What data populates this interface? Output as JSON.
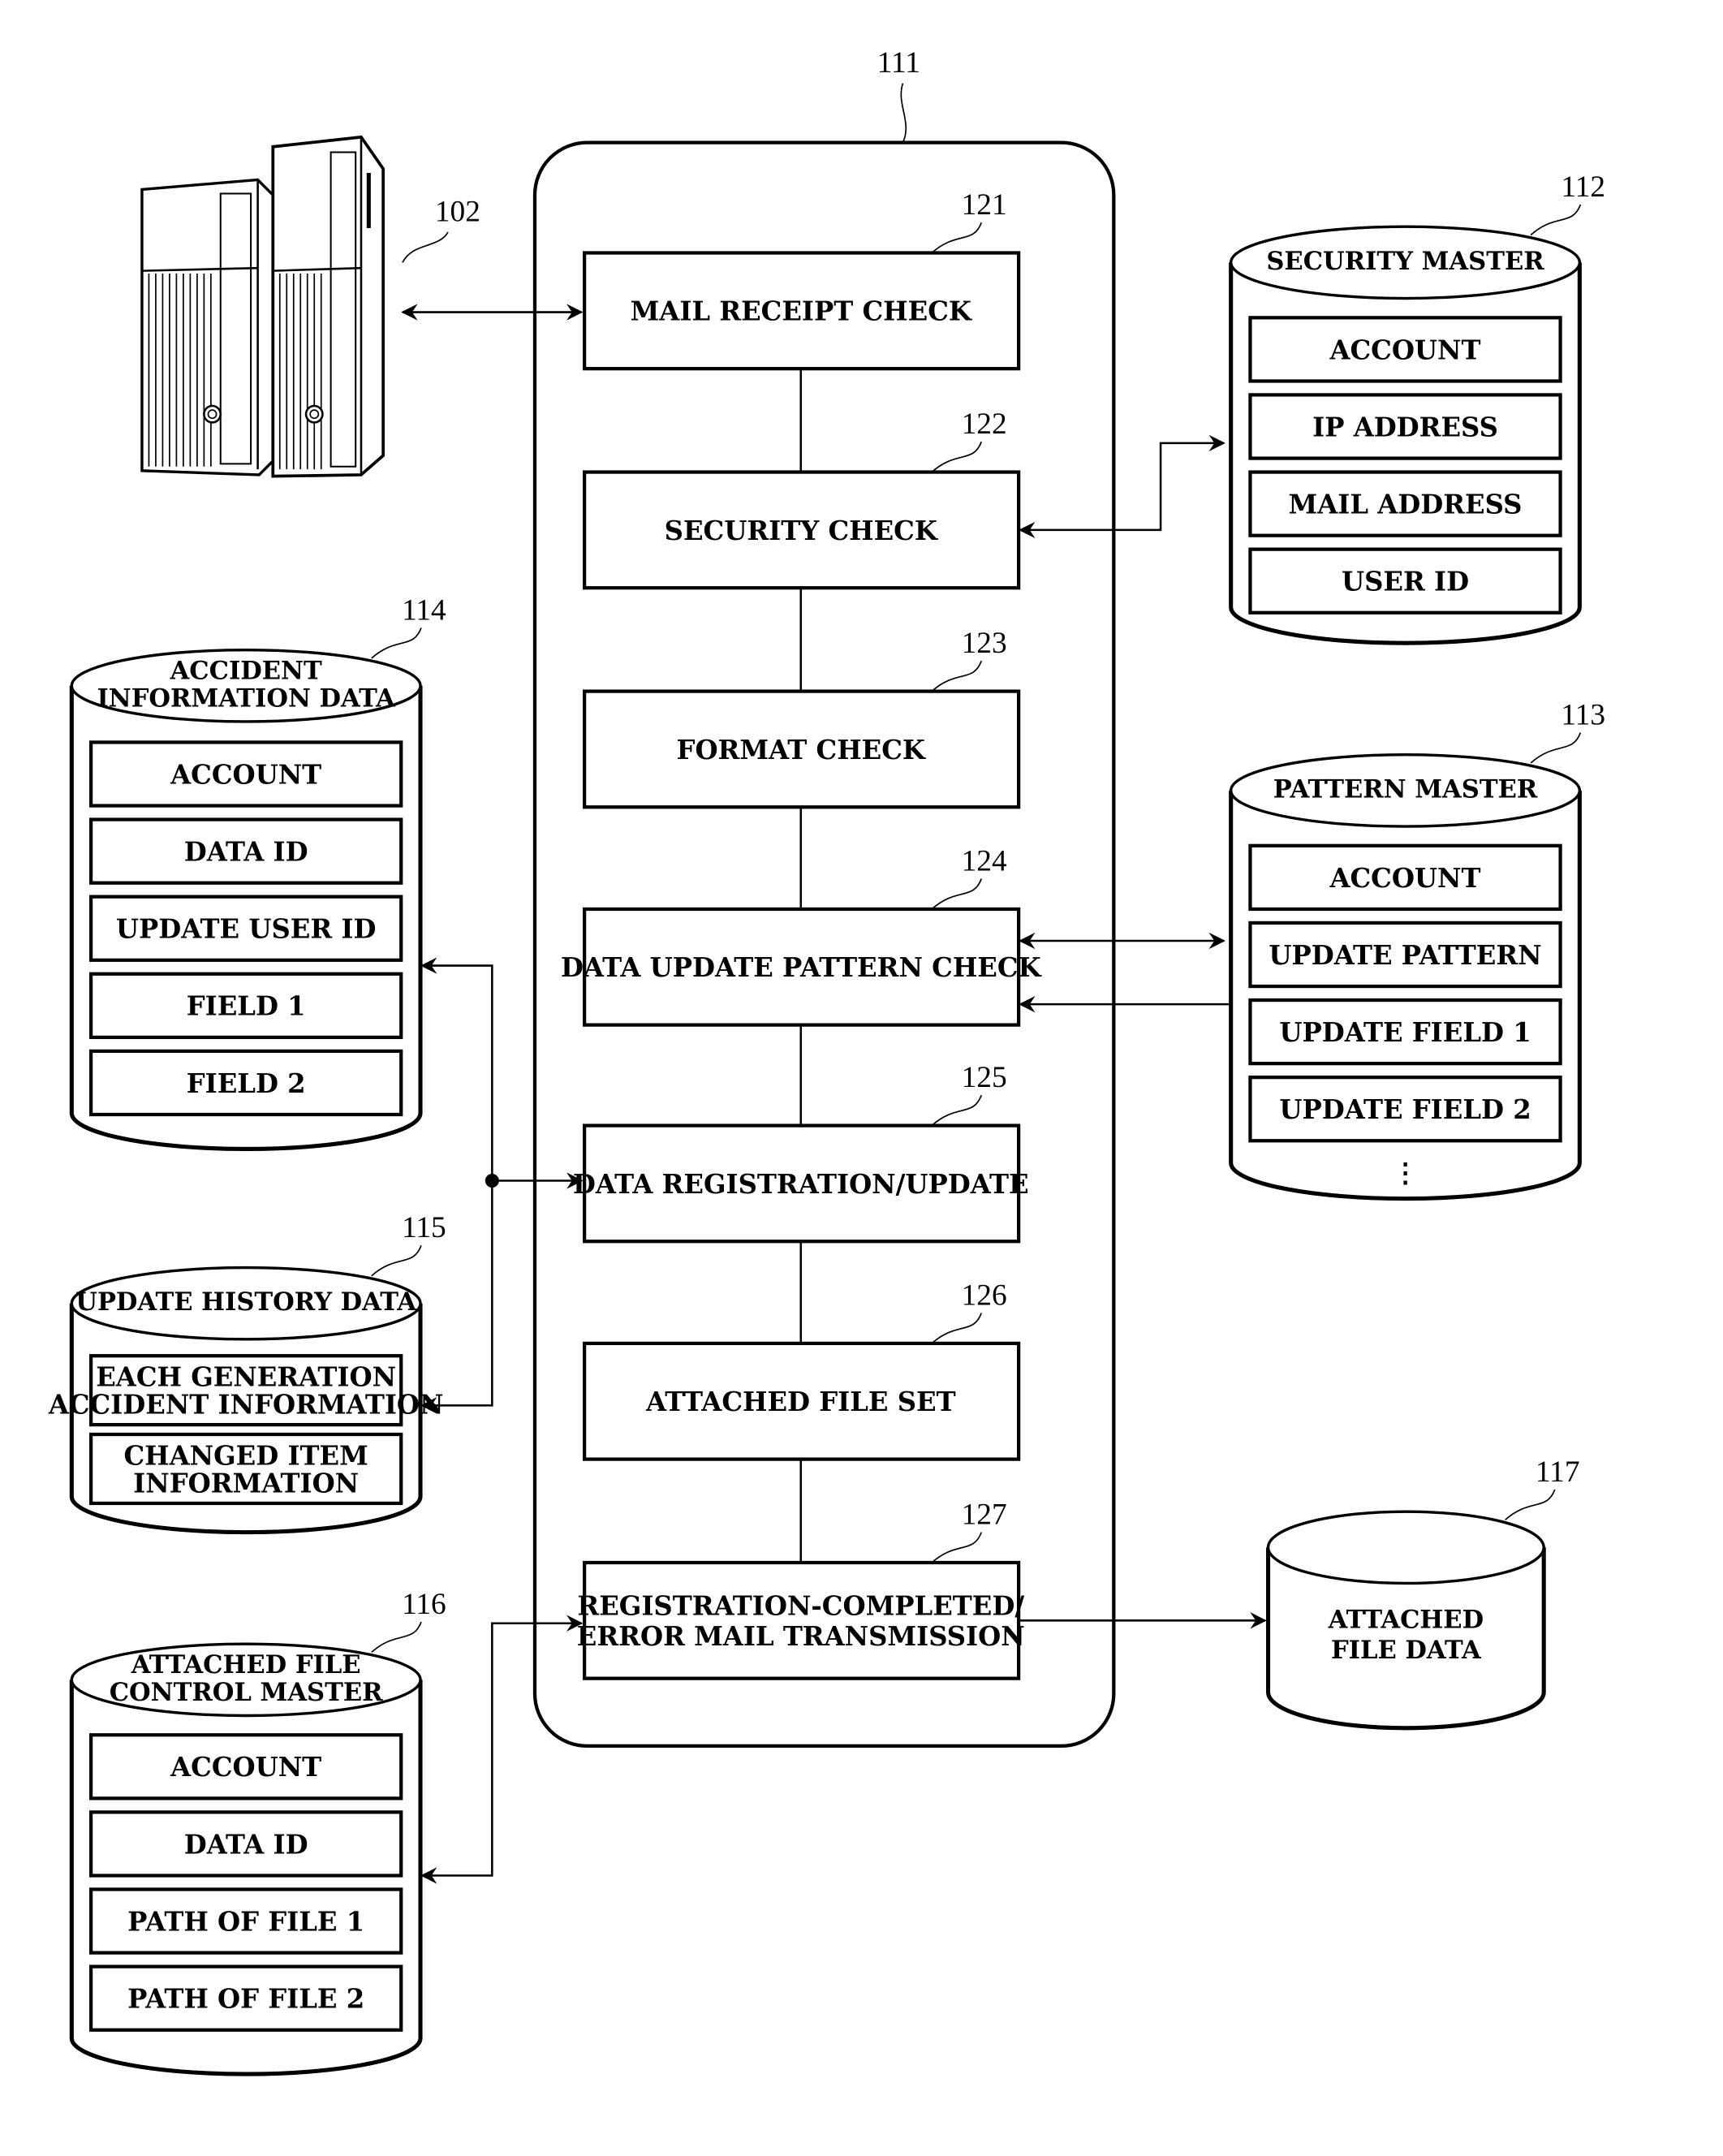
{
  "figure": {
    "colors": {
      "line": "#000000",
      "background": "#ffffff"
    },
    "server": {
      "ref": "102",
      "icon": "server-towers-icon"
    },
    "controller": {
      "ref": "111",
      "steps": [
        {
          "ref": "121",
          "label_lines": [
            "MAIL RECEIPT CHECK"
          ]
        },
        {
          "ref": "122",
          "label_lines": [
            "SECURITY CHECK"
          ]
        },
        {
          "ref": "123",
          "label_lines": [
            "FORMAT CHECK"
          ]
        },
        {
          "ref": "124",
          "label_lines": [
            "DATA UPDATE PATTERN CHECK"
          ]
        },
        {
          "ref": "125",
          "label_lines": [
            "DATA REGISTRATION/UPDATE"
          ]
        },
        {
          "ref": "126",
          "label_lines": [
            "ATTACHED FILE SET"
          ]
        },
        {
          "ref": "127",
          "label_lines": [
            "REGISTRATION-COMPLETED/",
            "ERROR MAIL TRANSMISSION"
          ]
        }
      ]
    },
    "databases": {
      "security_master": {
        "ref": "112",
        "title_lines": [
          "SECURITY MASTER"
        ],
        "fields": [
          [
            "ACCOUNT"
          ],
          [
            "IP ADDRESS"
          ],
          [
            "MAIL ADDRESS"
          ],
          [
            "USER ID"
          ]
        ]
      },
      "pattern_master": {
        "ref": "113",
        "title_lines": [
          "PATTERN MASTER"
        ],
        "fields": [
          [
            "ACCOUNT"
          ],
          [
            "UPDATE PATTERN"
          ],
          [
            "UPDATE FIELD 1"
          ],
          [
            "UPDATE FIELD 2"
          ]
        ],
        "continuation": "⋮"
      },
      "accident_information_data": {
        "ref": "114",
        "title_lines": [
          "ACCIDENT",
          "INFORMATION DATA"
        ],
        "fields": [
          [
            "ACCOUNT"
          ],
          [
            "DATA ID"
          ],
          [
            "UPDATE USER ID"
          ],
          [
            "FIELD 1"
          ],
          [
            "FIELD 2"
          ]
        ]
      },
      "update_history_data": {
        "ref": "115",
        "title_lines": [
          "UPDATE HISTORY DATA"
        ],
        "fields": [
          [
            "EACH GENERATION",
            "ACCIDENT INFORMATION"
          ],
          [
            "CHANGED ITEM",
            "INFORMATION"
          ]
        ]
      },
      "attached_file_control_master": {
        "ref": "116",
        "title_lines": [
          "ATTACHED FILE",
          "CONTROL MASTER"
        ],
        "fields": [
          [
            "ACCOUNT"
          ],
          [
            "DATA ID"
          ],
          [
            "PATH OF FILE 1"
          ],
          [
            "PATH OF FILE 2"
          ]
        ]
      },
      "attached_file_data": {
        "ref": "117",
        "body_lines": [
          "ATTACHED",
          "FILE DATA"
        ]
      }
    }
  }
}
